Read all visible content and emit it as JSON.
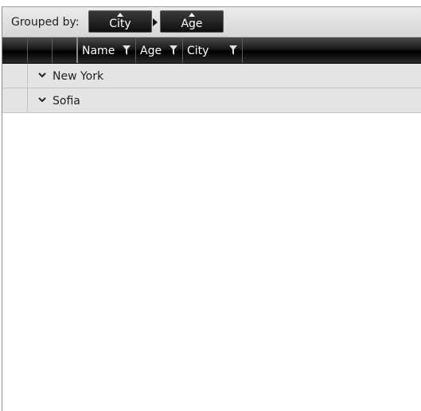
{
  "grouping_panel": {
    "label": "Grouped by:",
    "chips": [
      {
        "label": "City",
        "sort_icon": "sort-ascending-icon"
      },
      {
        "label": "Age",
        "sort_icon": "sort-ascending-icon"
      }
    ]
  },
  "grid": {
    "columns": [
      {
        "label": "Name",
        "filter_icon": "filter-icon"
      },
      {
        "label": "Age",
        "filter_icon": "filter-icon"
      },
      {
        "label": "City",
        "filter_icon": "filter-icon"
      }
    ],
    "groups": [
      {
        "label": "New York",
        "icon": "chevron-down-icon"
      },
      {
        "label": "Sofia",
        "icon": "chevron-down-icon"
      }
    ]
  },
  "colors": {
    "header_bg": "#000000",
    "header_text": "#ffffff",
    "group_row_bg": "#e4e4e4",
    "panel_bg": "#dcdcdc"
  }
}
